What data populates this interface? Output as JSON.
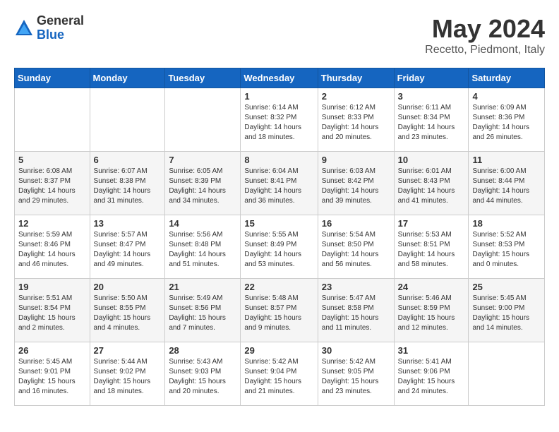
{
  "logo": {
    "general": "General",
    "blue": "Blue"
  },
  "title": "May 2024",
  "location": "Recetto, Piedmont, Italy",
  "weekdays": [
    "Sunday",
    "Monday",
    "Tuesday",
    "Wednesday",
    "Thursday",
    "Friday",
    "Saturday"
  ],
  "weeks": [
    [
      {
        "day": "",
        "info": ""
      },
      {
        "day": "",
        "info": ""
      },
      {
        "day": "",
        "info": ""
      },
      {
        "day": "1",
        "info": "Sunrise: 6:14 AM\nSunset: 8:32 PM\nDaylight: 14 hours\nand 18 minutes."
      },
      {
        "day": "2",
        "info": "Sunrise: 6:12 AM\nSunset: 8:33 PM\nDaylight: 14 hours\nand 20 minutes."
      },
      {
        "day": "3",
        "info": "Sunrise: 6:11 AM\nSunset: 8:34 PM\nDaylight: 14 hours\nand 23 minutes."
      },
      {
        "day": "4",
        "info": "Sunrise: 6:09 AM\nSunset: 8:36 PM\nDaylight: 14 hours\nand 26 minutes."
      }
    ],
    [
      {
        "day": "5",
        "info": "Sunrise: 6:08 AM\nSunset: 8:37 PM\nDaylight: 14 hours\nand 29 minutes."
      },
      {
        "day": "6",
        "info": "Sunrise: 6:07 AM\nSunset: 8:38 PM\nDaylight: 14 hours\nand 31 minutes."
      },
      {
        "day": "7",
        "info": "Sunrise: 6:05 AM\nSunset: 8:39 PM\nDaylight: 14 hours\nand 34 minutes."
      },
      {
        "day": "8",
        "info": "Sunrise: 6:04 AM\nSunset: 8:41 PM\nDaylight: 14 hours\nand 36 minutes."
      },
      {
        "day": "9",
        "info": "Sunrise: 6:03 AM\nSunset: 8:42 PM\nDaylight: 14 hours\nand 39 minutes."
      },
      {
        "day": "10",
        "info": "Sunrise: 6:01 AM\nSunset: 8:43 PM\nDaylight: 14 hours\nand 41 minutes."
      },
      {
        "day": "11",
        "info": "Sunrise: 6:00 AM\nSunset: 8:44 PM\nDaylight: 14 hours\nand 44 minutes."
      }
    ],
    [
      {
        "day": "12",
        "info": "Sunrise: 5:59 AM\nSunset: 8:46 PM\nDaylight: 14 hours\nand 46 minutes."
      },
      {
        "day": "13",
        "info": "Sunrise: 5:57 AM\nSunset: 8:47 PM\nDaylight: 14 hours\nand 49 minutes."
      },
      {
        "day": "14",
        "info": "Sunrise: 5:56 AM\nSunset: 8:48 PM\nDaylight: 14 hours\nand 51 minutes."
      },
      {
        "day": "15",
        "info": "Sunrise: 5:55 AM\nSunset: 8:49 PM\nDaylight: 14 hours\nand 53 minutes."
      },
      {
        "day": "16",
        "info": "Sunrise: 5:54 AM\nSunset: 8:50 PM\nDaylight: 14 hours\nand 56 minutes."
      },
      {
        "day": "17",
        "info": "Sunrise: 5:53 AM\nSunset: 8:51 PM\nDaylight: 14 hours\nand 58 minutes."
      },
      {
        "day": "18",
        "info": "Sunrise: 5:52 AM\nSunset: 8:53 PM\nDaylight: 15 hours\nand 0 minutes."
      }
    ],
    [
      {
        "day": "19",
        "info": "Sunrise: 5:51 AM\nSunset: 8:54 PM\nDaylight: 15 hours\nand 2 minutes."
      },
      {
        "day": "20",
        "info": "Sunrise: 5:50 AM\nSunset: 8:55 PM\nDaylight: 15 hours\nand 4 minutes."
      },
      {
        "day": "21",
        "info": "Sunrise: 5:49 AM\nSunset: 8:56 PM\nDaylight: 15 hours\nand 7 minutes."
      },
      {
        "day": "22",
        "info": "Sunrise: 5:48 AM\nSunset: 8:57 PM\nDaylight: 15 hours\nand 9 minutes."
      },
      {
        "day": "23",
        "info": "Sunrise: 5:47 AM\nSunset: 8:58 PM\nDaylight: 15 hours\nand 11 minutes."
      },
      {
        "day": "24",
        "info": "Sunrise: 5:46 AM\nSunset: 8:59 PM\nDaylight: 15 hours\nand 12 minutes."
      },
      {
        "day": "25",
        "info": "Sunrise: 5:45 AM\nSunset: 9:00 PM\nDaylight: 15 hours\nand 14 minutes."
      }
    ],
    [
      {
        "day": "26",
        "info": "Sunrise: 5:45 AM\nSunset: 9:01 PM\nDaylight: 15 hours\nand 16 minutes."
      },
      {
        "day": "27",
        "info": "Sunrise: 5:44 AM\nSunset: 9:02 PM\nDaylight: 15 hours\nand 18 minutes."
      },
      {
        "day": "28",
        "info": "Sunrise: 5:43 AM\nSunset: 9:03 PM\nDaylight: 15 hours\nand 20 minutes."
      },
      {
        "day": "29",
        "info": "Sunrise: 5:42 AM\nSunset: 9:04 PM\nDaylight: 15 hours\nand 21 minutes."
      },
      {
        "day": "30",
        "info": "Sunrise: 5:42 AM\nSunset: 9:05 PM\nDaylight: 15 hours\nand 23 minutes."
      },
      {
        "day": "31",
        "info": "Sunrise: 5:41 AM\nSunset: 9:06 PM\nDaylight: 15 hours\nand 24 minutes."
      },
      {
        "day": "",
        "info": ""
      }
    ]
  ]
}
